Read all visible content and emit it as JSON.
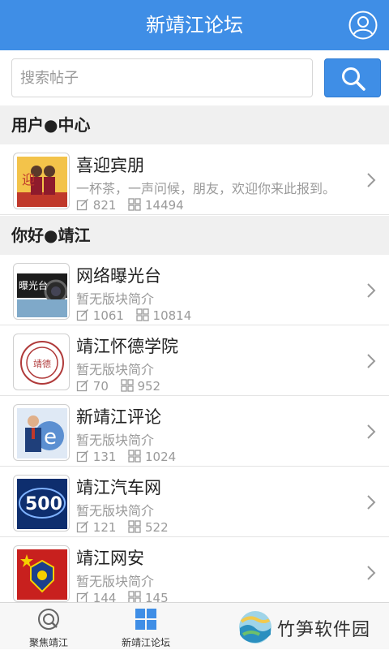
{
  "header": {
    "title": "新靖江论坛",
    "user_icon": "user-icon"
  },
  "search": {
    "placeholder": "搜索帖子",
    "button_icon": "search-icon"
  },
  "sections": [
    {
      "title": "用户●中心"
    },
    {
      "title": "你好●靖江"
    }
  ],
  "boards": [
    {
      "name": "喜迎宾朋",
      "desc": "一杯茶，一声问候，朋友，欢迎你来此报到。",
      "posts": "821",
      "topics": "14494"
    },
    {
      "name": "网络曝光台",
      "desc": "暂无版块简介",
      "posts": "1061",
      "topics": "10814"
    },
    {
      "name": "靖江怀德学院",
      "desc": "暂无版块简介",
      "posts": "70",
      "topics": "952"
    },
    {
      "name": "新靖江评论",
      "desc": "暂无版块简介",
      "posts": "131",
      "topics": "1024"
    },
    {
      "name": "靖江汽车网",
      "desc": "暂无版块简介",
      "posts": "121",
      "topics": "522"
    },
    {
      "name": "靖江网安",
      "desc": "暂无版块简介",
      "posts": "144",
      "topics": "145"
    }
  ],
  "thumb_text": {
    "b1": "迎",
    "b2": "曝光台",
    "b3": "靖德",
    "b5": "500"
  },
  "tabs": [
    {
      "label": "聚焦靖江"
    },
    {
      "label": "新靖江论坛"
    }
  ],
  "watermark": {
    "text": "竹笋软件园"
  },
  "colors": {
    "accent": "#3f8ee6",
    "section_bg": "#f0f0f0",
    "muted": "#9a9a9a"
  }
}
